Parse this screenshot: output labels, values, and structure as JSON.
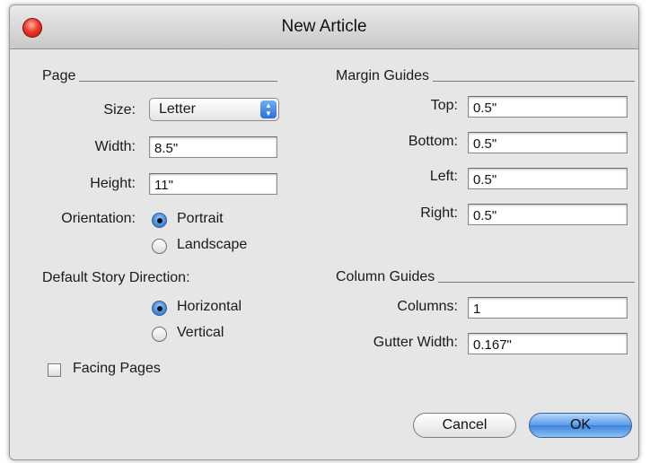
{
  "window": {
    "title": "New Article"
  },
  "page": {
    "heading": "Page",
    "size_label": "Size:",
    "size_value": "Letter",
    "width_label": "Width:",
    "width_value": "8.5\"",
    "height_label": "Height:",
    "height_value": "11\"",
    "orientation_label": "Orientation:",
    "orientation_options": [
      {
        "label": "Portrait",
        "selected": true
      },
      {
        "label": "Landscape",
        "selected": false
      }
    ]
  },
  "story": {
    "heading": "Default Story Direction:",
    "options": [
      {
        "label": "Horizontal",
        "selected": true
      },
      {
        "label": "Vertical",
        "selected": false
      }
    ]
  },
  "facing_pages": {
    "label": "Facing Pages",
    "checked": false
  },
  "margin_guides": {
    "heading": "Margin Guides",
    "top_label": "Top:",
    "top_value": "0.5\"",
    "bottom_label": "Bottom:",
    "bottom_value": "0.5\"",
    "left_label": "Left:",
    "left_value": "0.5\"",
    "right_label": "Right:",
    "right_value": "0.5\""
  },
  "column_guides": {
    "heading": "Column Guides",
    "columns_label": "Columns:",
    "columns_value": "1",
    "gutter_label": "Gutter Width:",
    "gutter_value": "0.167\""
  },
  "buttons": {
    "cancel": "Cancel",
    "ok": "OK"
  }
}
